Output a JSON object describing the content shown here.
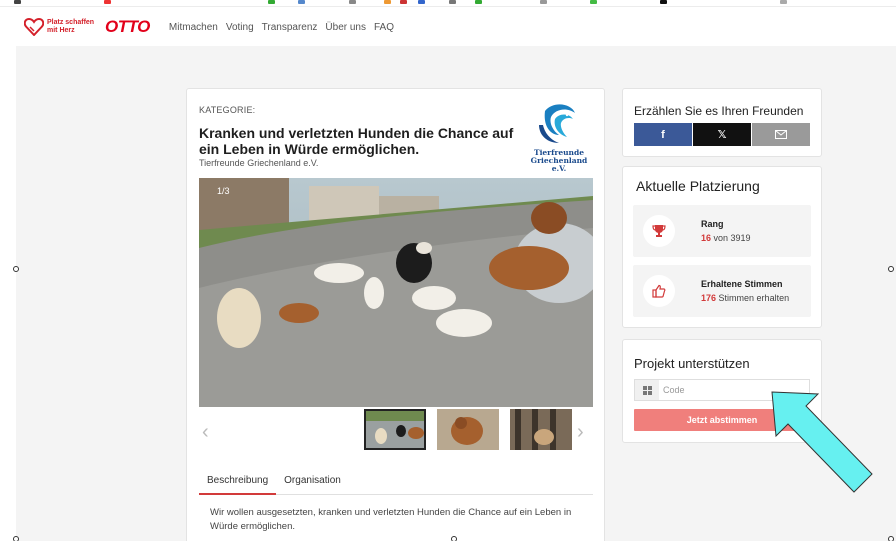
{
  "header": {
    "brand_line1": "Platz schaffen",
    "brand_line2": "mit Herz",
    "otto_logo": "OTTO",
    "nav": [
      "Mitmachen",
      "Voting",
      "Transparenz",
      "Über uns",
      "FAQ"
    ]
  },
  "project": {
    "category_label": "KATEGORIE:",
    "title": "Kranken und verletzten Hunden die Chance auf ein Leben in Würde ermöglichen.",
    "organization": "Tierfreunde Griechenland e.V.",
    "logo_text_line1": "Tierfreunde",
    "logo_text_line2": "Griechenland e.V.",
    "photo_counter": "1/3",
    "tabs": [
      "Beschreibung",
      "Organisation"
    ],
    "active_tab": "Beschreibung",
    "description": "Wir wollen ausgesetzten, kranken und verletzten Hunden die Chance auf ein Leben in Würde ermöglichen."
  },
  "share": {
    "title": "Erzählen Sie es Ihren Freunden",
    "facebook_icon": "f",
    "x_icon": "𝕏",
    "mail_icon": "mail-icon"
  },
  "ranking": {
    "title": "Aktuelle Platzierung",
    "rank_label": "Rang",
    "rank_value": "16",
    "rank_suffix": "von 3919",
    "votes_label": "Erhaltene Stimmen",
    "votes_value": "176",
    "votes_suffix": "Stimmen erhalten"
  },
  "support": {
    "title": "Projekt unterstützen",
    "code_placeholder": "Code",
    "vote_button": "Jetzt abstimmen"
  },
  "colors": {
    "accent_red": "#d23a3a",
    "vote_button": "#f07f7c",
    "facebook": "#3b5998",
    "arrow": "#66f0f0"
  }
}
